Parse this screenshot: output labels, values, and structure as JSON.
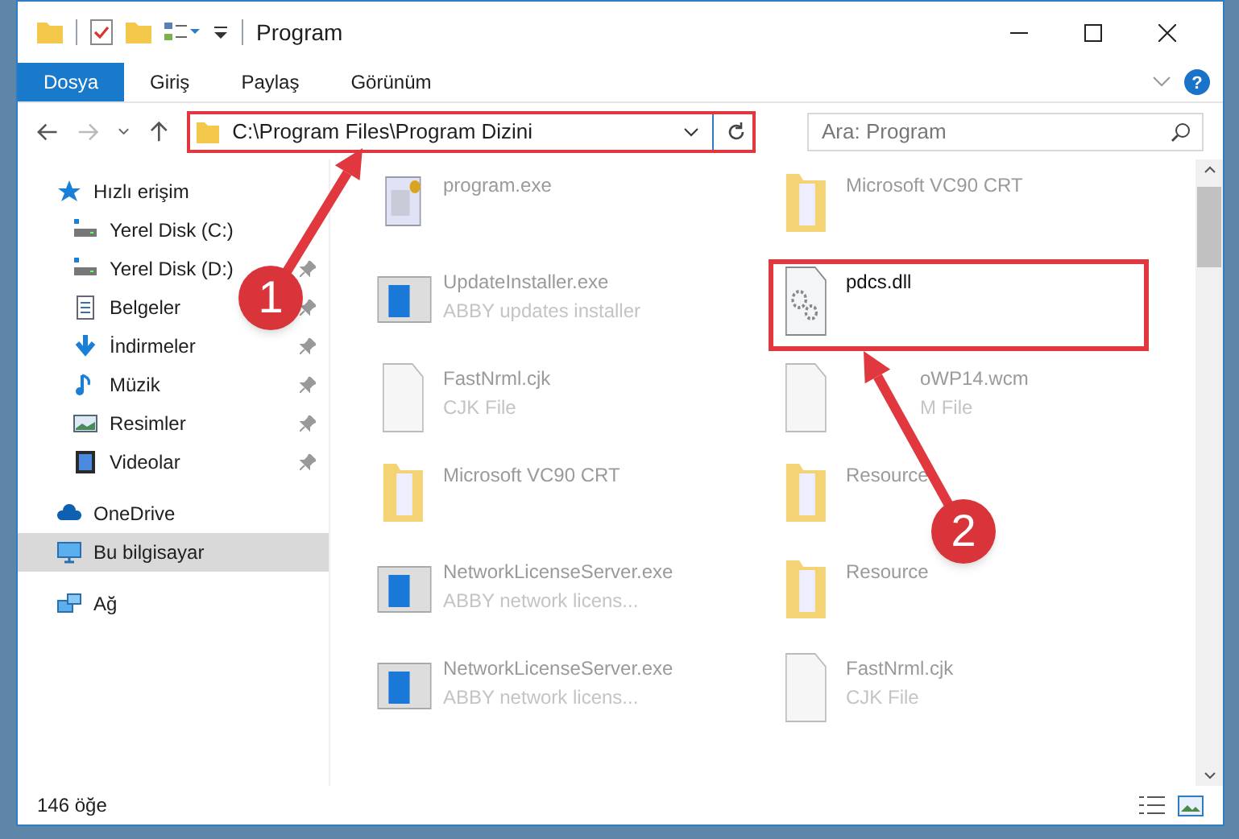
{
  "window": {
    "title": "Program"
  },
  "ribbon_tabs": [
    {
      "label": "Dosya",
      "selected": true
    },
    {
      "label": "Giriş",
      "selected": false
    },
    {
      "label": "Paylaş",
      "selected": false
    },
    {
      "label": "Görünüm",
      "selected": false
    }
  ],
  "address_bar": {
    "path": "C:\\Program Files\\Program Dizini"
  },
  "help_button": {
    "glyph": "?"
  },
  "search": {
    "placeholder": "Ara: Program"
  },
  "sidebar": {
    "items": [
      {
        "label": "Hızlı erişim",
        "kind": "star",
        "pinned": false,
        "selected": false
      },
      {
        "label": "Yerel Disk (C:)",
        "kind": "drive",
        "pinned": false,
        "selected": false
      },
      {
        "label": "Yerel Disk (D:)",
        "kind": "drive",
        "pinned": true,
        "selected": false
      },
      {
        "label": "Belgeler",
        "kind": "docs",
        "pinned": true,
        "selected": false
      },
      {
        "label": "İndirmeler",
        "kind": "download",
        "pinned": true,
        "selected": false
      },
      {
        "label": "Müzik",
        "kind": "music",
        "pinned": true,
        "selected": false
      },
      {
        "label": "Resimler",
        "kind": "pictures",
        "pinned": true,
        "selected": false
      },
      {
        "label": "Videolar",
        "kind": "videos",
        "pinned": true,
        "selected": false
      },
      {
        "label": "OneDrive",
        "kind": "cloud",
        "pinned": false,
        "selected": false
      },
      {
        "label": "Bu bilgisayar",
        "kind": "pc",
        "pinned": false,
        "selected": true
      },
      {
        "label": "Ağ",
        "kind": "network",
        "pinned": false,
        "selected": false
      }
    ]
  },
  "files": [
    {
      "name": "program.exe",
      "kind": "exe"
    },
    {
      "name": "Microsoft VC90 CRT",
      "kind": "folder"
    },
    {
      "name": "UpdateInstaller.exe",
      "detail": "ABBY updates installer",
      "kind": "app"
    },
    {
      "name": "pdcs.dll",
      "kind": "dll",
      "highlighted": true
    },
    {
      "name": "FastNrml.cjk",
      "detail": "CJK File",
      "kind": "file"
    },
    {
      "name": "oWP14.wcm",
      "detail": "M File",
      "kind": "file"
    },
    {
      "name": "Microsoft VC90 CRT",
      "kind": "folder"
    },
    {
      "name": "Resource",
      "kind": "folder"
    },
    {
      "name": "NetworkLicenseServer.exe",
      "detail": "ABBY network licens...",
      "kind": "app"
    },
    {
      "name": "Resource",
      "kind": "folder"
    },
    {
      "name": "NetworkLicenseServer.exe",
      "detail": "ABBY network licens...",
      "kind": "app"
    },
    {
      "name": "FastNrml.cjk",
      "detail": "CJK File",
      "kind": "file"
    }
  ],
  "status_bar": {
    "item_count": "146 öğe"
  },
  "annotations": [
    {
      "number": "1"
    },
    {
      "number": "2"
    }
  ]
}
